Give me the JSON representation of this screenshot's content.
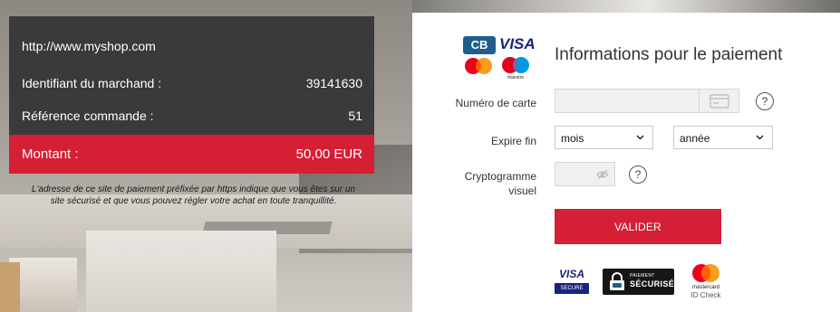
{
  "merchant": {
    "site_url": "http://www.myshop.com",
    "merchant_id_label": "Identifiant du marchand :",
    "merchant_id_value": "39141630",
    "order_ref_label": "Référence commande :",
    "order_ref_value": "51",
    "amount_label": "Montant :",
    "amount_value": "50,00 EUR"
  },
  "secure_note": {
    "line1": "L'adresse de ce site de paiement préfixée par https indique que vous êtes sur un",
    "line2": "site sécurisé et que vous pouvez régler votre achat en toute tranquillité."
  },
  "form": {
    "title": "Informations pour le paiement",
    "card_number_label": "Numéro de carte",
    "card_number_value": "",
    "expire_label": "Expire fin",
    "month_value": "mois",
    "year_value": "année",
    "cvv_label_line1": "Cryptogramme",
    "cvv_label_line2": "visuel",
    "cvv_value": "",
    "help_symbol": "?",
    "submit_label": "VALIDER"
  },
  "logos": {
    "cb_text": "CB",
    "visa_text": "VISA",
    "maestro_text": "maestro",
    "visa_secure_top": "VISA",
    "visa_secure_bottom": "SECURE",
    "pay_secure_top": "PAIEMENT",
    "pay_secure_bottom": "SÉCURISÉ",
    "mastercard_text": "mastercard",
    "id_check_text": "ID Check"
  },
  "colors": {
    "accent_red": "#d51f35",
    "panel_dark": "#3a3a3a",
    "visa_blue": "#1a237e",
    "cb_blue": "#1f5e8c"
  },
  "icons": [
    "card-icon",
    "help-icon",
    "eye-off-icon",
    "chevron-down-icon",
    "lock-icon"
  ]
}
